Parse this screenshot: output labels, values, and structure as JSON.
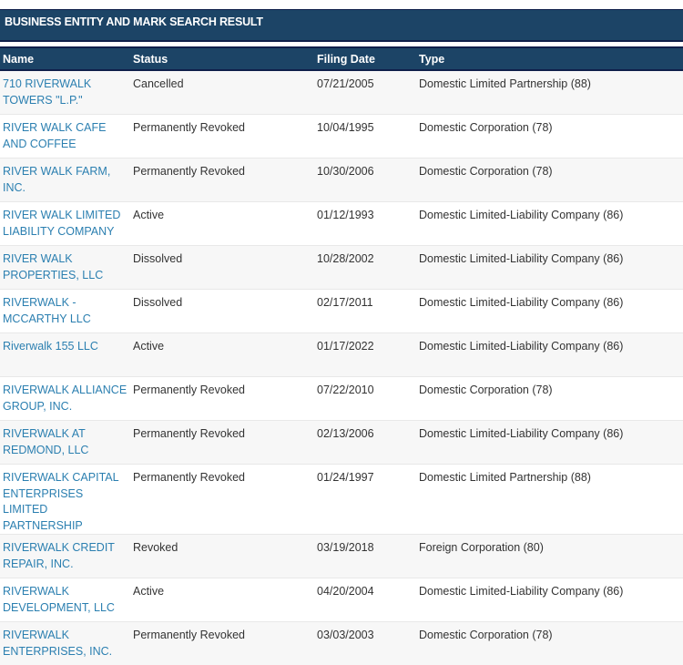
{
  "title": "BUSINESS ENTITY AND MARK SEARCH RESULT",
  "table": {
    "columns": [
      "Name",
      "Status",
      "Filing Date",
      "Type"
    ],
    "rows": [
      {
        "name": "710 RIVERWALK TOWERS \"L.P.\"",
        "status": "Cancelled",
        "filing_date": "07/21/2005",
        "type": "Domestic Limited Partnership (88)"
      },
      {
        "name": "RIVER WALK CAFE AND COFFEE",
        "status": "Permanently Revoked",
        "filing_date": "10/04/1995",
        "type": "Domestic Corporation (78)"
      },
      {
        "name": "RIVER WALK FARM, INC.",
        "status": "Permanently Revoked",
        "filing_date": "10/30/2006",
        "type": "Domestic Corporation (78)"
      },
      {
        "name": "RIVER WALK LIMITED LIABILITY COMPANY",
        "status": "Active",
        "filing_date": "01/12/1993",
        "type": "Domestic Limited-Liability Company (86)"
      },
      {
        "name": "RIVER WALK PROPERTIES, LLC",
        "status": "Dissolved",
        "filing_date": "10/28/2002",
        "type": "Domestic Limited-Liability Company (86)"
      },
      {
        "name": "RIVERWALK - MCCARTHY LLC",
        "status": "Dissolved",
        "filing_date": "02/17/2011",
        "type": "Domestic Limited-Liability Company (86)"
      },
      {
        "name": "Riverwalk 155 LLC",
        "status": "Active",
        "filing_date": "01/17/2022",
        "type": "Domestic Limited-Liability Company (86)"
      },
      {
        "name": "RIVERWALK ALLIANCE GROUP, INC.",
        "status": "Permanently Revoked",
        "filing_date": "07/22/2010",
        "type": "Domestic Corporation (78)"
      },
      {
        "name": "RIVERWALK AT REDMOND, LLC",
        "status": "Permanently Revoked",
        "filing_date": "02/13/2006",
        "type": "Domestic Limited-Liability Company (86)"
      },
      {
        "name": "RIVERWALK CAPITAL ENTERPRISES LIMITED PARTNERSHIP",
        "status": "Permanently Revoked",
        "filing_date": "01/24/1997",
        "type": "Domestic Limited Partnership (88)"
      },
      {
        "name": "RIVERWALK CREDIT REPAIR, INC.",
        "status": "Revoked",
        "filing_date": "03/19/2018",
        "type": "Foreign Corporation (80)"
      },
      {
        "name": "RIVERWALK DEVELOPMENT, LLC",
        "status": "Active",
        "filing_date": "04/20/2004",
        "type": "Domestic Limited-Liability Company (86)"
      },
      {
        "name": "RIVERWALK ENTERPRISES, INC.",
        "status": "Permanently Revoked",
        "filing_date": "03/03/2003",
        "type": "Domestic Corporation (78)"
      }
    ]
  },
  "colors": {
    "header_bg": "#1c4466",
    "header_border": "#0f1f4a",
    "link": "#2b7fb0",
    "row_alt": "#f7f7f7"
  }
}
